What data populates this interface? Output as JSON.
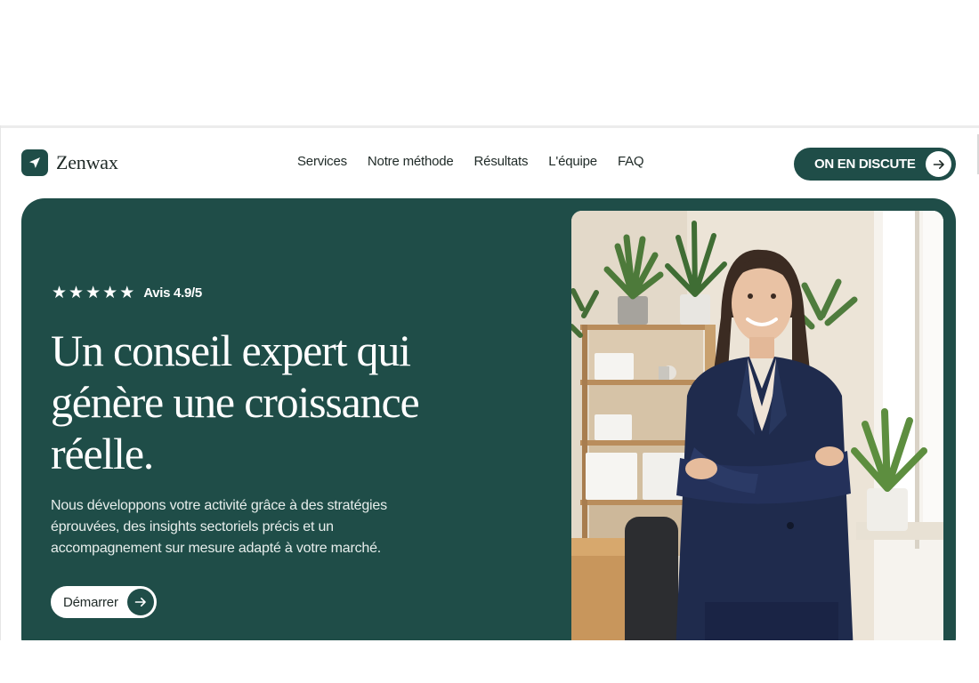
{
  "brand": {
    "name": "Zenwax",
    "icon": "paper-plane-icon",
    "color": "#1f4d48"
  },
  "nav": {
    "items": [
      {
        "label": "Services"
      },
      {
        "label": "Notre méthode"
      },
      {
        "label": "Résultats"
      },
      {
        "label": "L'équipe"
      },
      {
        "label": "FAQ"
      }
    ]
  },
  "header": {
    "cta_label": "ON EN DISCUTE",
    "cta_icon": "arrow-right-icon"
  },
  "hero": {
    "rating": {
      "stars": 5,
      "text": "Avis 4.9/5"
    },
    "headline": "Un conseil expert qui génère une croissance réelle.",
    "subtext": "Nous développons votre activité grâce à des stratégies éprouvées, des insights sectoriels précis et un accompagnement sur mesure adapté à votre marché.",
    "button_label": "Démarrer",
    "button_icon": "arrow-right-icon",
    "background_color": "#1f4d48",
    "image": "smiling-businesswoman-in-navy-suit-office-photo"
  }
}
